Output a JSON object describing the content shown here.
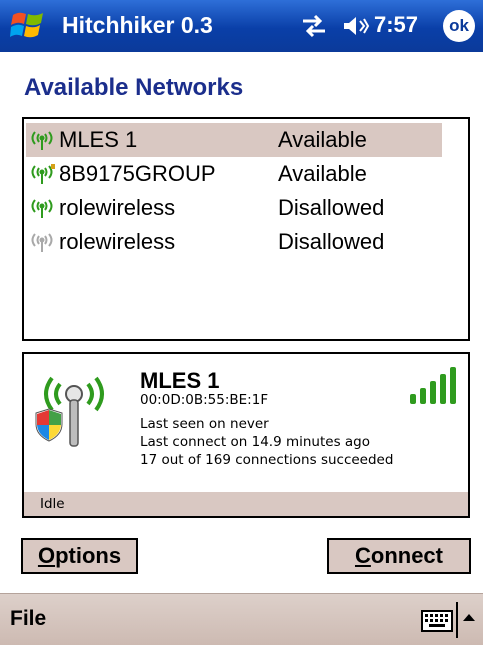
{
  "titlebar": {
    "app_title": "Hitchhiker 0.3",
    "time": "7:57",
    "ok_label": "ok",
    "icons": [
      "windows-start-icon",
      "connectivity-icon",
      "volume-icon"
    ]
  },
  "page_title": "Available Networks",
  "networks": [
    {
      "name": "MLES 1",
      "status": "Available",
      "selected": true,
      "signal_icon": "wireless-signal-green-icon"
    },
    {
      "name": "8B9175GROUP",
      "status": "Available",
      "selected": false,
      "signal_icon": "wireless-signal-green-locked-icon"
    },
    {
      "name": "rolewireless",
      "status": "Disallowed",
      "selected": false,
      "signal_icon": "wireless-signal-green-icon"
    },
    {
      "name": "rolewireless",
      "status": "Disallowed",
      "selected": false,
      "signal_icon": "wireless-signal-gray-icon"
    }
  ],
  "detail": {
    "name": "MLES 1",
    "mac": "00:0D:0B:55:BE:1F",
    "last_seen": "Last seen on never",
    "last_connect": "Last connect on 14.9 minutes ago",
    "connections": "17 out of 169 connections succeeded",
    "status": "Idle",
    "signal_bars": 5
  },
  "buttons": {
    "options_first": "O",
    "options_rest": "ptions",
    "connect_first": "C",
    "connect_rest": "onnect"
  },
  "menubar": {
    "file_label": "File"
  },
  "colors": {
    "titlebar": "#0b3a9a",
    "accent_text": "#1b2e8c",
    "selection": "#d9c8c2",
    "signal_green": "#2f9b1e"
  }
}
